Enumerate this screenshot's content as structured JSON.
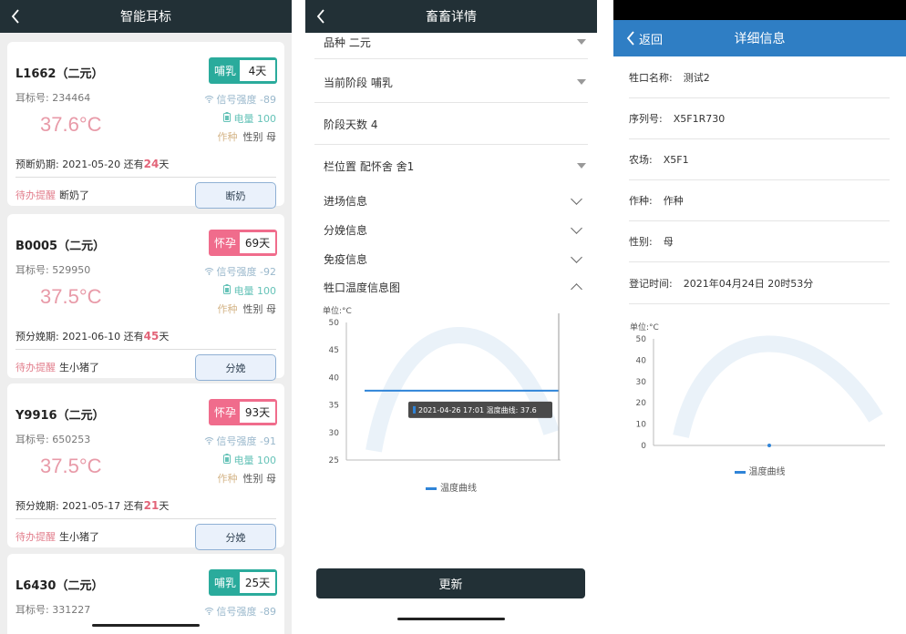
{
  "panel1": {
    "title": "智能耳标",
    "cards": [
      {
        "id": "L1662（二元）",
        "ear_label": "耳标号:",
        "ear": "234464",
        "temp": "37.6°C",
        "status": "哺乳",
        "days": "4天",
        "signal": "信号强度 -89",
        "battery": "电量 100",
        "kind": "作种",
        "sex": "性别 母",
        "due_text": "预断奶期: 2021-05-20  还有",
        "due_days": "24",
        "due_unit": "天",
        "todo_label": "待办提醒",
        "todo": "断奶了",
        "action": "断奶",
        "color": "green"
      },
      {
        "id": "B0005（二元）",
        "ear_label": "耳标号:",
        "ear": "529950",
        "temp": "37.5°C",
        "status": "怀孕",
        "days": "69天",
        "signal": "信号强度 -92",
        "battery": "电量 100",
        "kind": "作种",
        "sex": "性别 母",
        "due_text": "预分娩期: 2021-06-10  还有",
        "due_days": "45",
        "due_unit": "天",
        "todo_label": "待办提醒",
        "todo": "生小猪了",
        "action": "分娩",
        "color": "pink"
      },
      {
        "id": "Y9916（二元）",
        "ear_label": "耳标号:",
        "ear": "650253",
        "temp": "37.5°C",
        "status": "怀孕",
        "days": "93天",
        "signal": "信号强度 -91",
        "battery": "电量 100",
        "kind": "作种",
        "sex": "性别 母",
        "due_text": "预分娩期: 2021-05-17  还有",
        "due_days": "21",
        "due_unit": "天",
        "todo_label": "待办提醒",
        "todo": "生小猪了",
        "action": "分娩",
        "color": "pink"
      },
      {
        "id": "L6430（二元）",
        "ear_label": "耳标号:",
        "ear": "331227",
        "status": "哺乳",
        "days": "25天",
        "signal": "信号强度 -89",
        "color": "green"
      }
    ]
  },
  "panel2": {
    "title": "畜畜详情",
    "rows": {
      "breed": "品种  二元",
      "stage": "当前阶段  哺乳",
      "stage_days": "阶段天数  4",
      "pen": "栏位置  配怀舍 舍1"
    },
    "sections": [
      "进场信息",
      "分娩信息",
      "免疫信息",
      "牲口温度信息图"
    ],
    "chart_data": {
      "type": "line",
      "ylabel": "单位:°C",
      "yticks": [
        "50",
        "45",
        "40",
        "35",
        "30",
        "25"
      ],
      "ylim": [
        25,
        50
      ],
      "series": [
        {
          "name": "温度曲线",
          "values": [
            37.6,
            37.6
          ]
        }
      ],
      "tooltip": "2021-04-26 17:01 温度曲线: 37.6",
      "legend": "温度曲线"
    },
    "update": "更新"
  },
  "panel3": {
    "back": "返回",
    "title": "详细信息",
    "fields": [
      {
        "k": "牲口名称:",
        "v": "测试2"
      },
      {
        "k": "序列号:",
        "v": "X5F1R730"
      },
      {
        "k": "农场:",
        "v": "X5F1"
      },
      {
        "k": "作种:",
        "v": "作种"
      },
      {
        "k": "性别:",
        "v": "母"
      },
      {
        "k": "登记时间:",
        "v": "2021年04月24日 20时53分"
      }
    ],
    "chart_data": {
      "type": "line",
      "ylabel": "单位:°C",
      "yticks": [
        "50",
        "40",
        "30",
        "20",
        "10",
        "0"
      ],
      "ylim": [
        0,
        50
      ],
      "series": [
        {
          "name": "温度曲线",
          "values": [
            0
          ]
        }
      ],
      "legend": "温度曲线"
    }
  }
}
